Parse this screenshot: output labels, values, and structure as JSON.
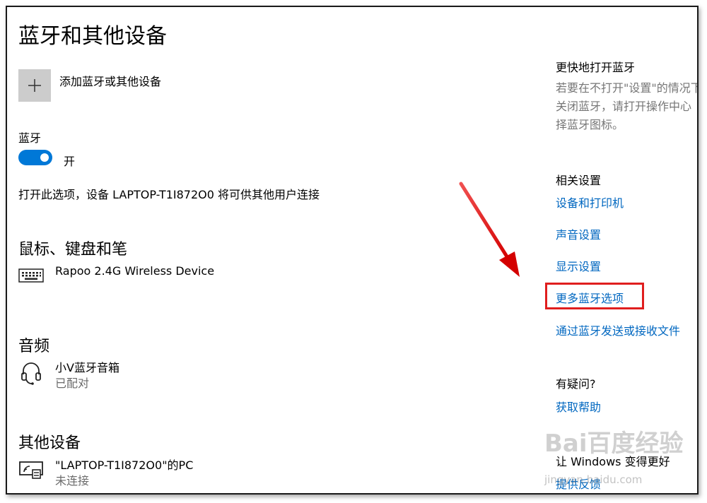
{
  "page": {
    "title": "蓝牙和其他设备"
  },
  "add_device": {
    "label": "添加蓝牙或其他设备"
  },
  "bluetooth": {
    "label": "蓝牙",
    "toggle_state": "开",
    "description": "打开此选项，设备 LAPTOP-T1I872O0 将可供其他用户连接"
  },
  "sections": {
    "mouse": {
      "heading": "鼠标、键盘和笔",
      "device": {
        "name": "Rapoo 2.4G Wireless Device",
        "icon": "keyboard-icon"
      }
    },
    "audio": {
      "heading": "音频",
      "device": {
        "name": "小V蓝牙音箱",
        "status": "已配对",
        "icon": "headset-icon"
      }
    },
    "other": {
      "heading": "其他设备",
      "device": {
        "name": "\"LAPTOP-T1I872O0\"的PC",
        "status": "未连接",
        "icon": "pc-wireless-icon"
      }
    }
  },
  "sidebar": {
    "quick": {
      "heading": "更快地打开蓝牙",
      "text_line1": "若要在不打开\"设置\"的情况下",
      "text_line2": "关闭蓝牙，请打开操作中心",
      "text_line3": "择蓝牙图标。"
    },
    "related": {
      "heading": "相关设置",
      "links": [
        "设备和打印机",
        "声音设置",
        "显示设置",
        "更多蓝牙选项",
        "通过蓝牙发送或接收文件"
      ]
    },
    "help": {
      "heading": "有疑问?",
      "link": "获取帮助"
    },
    "feedback": {
      "heading": "让 Windows 变得更好",
      "link": "提供反馈"
    }
  },
  "watermark": {
    "text": "Bai百度经验",
    "url": "jingyan.baidu.com"
  },
  "colors": {
    "accent": "#0078d7",
    "link": "#0067c0",
    "highlight": "#e01e1e"
  }
}
